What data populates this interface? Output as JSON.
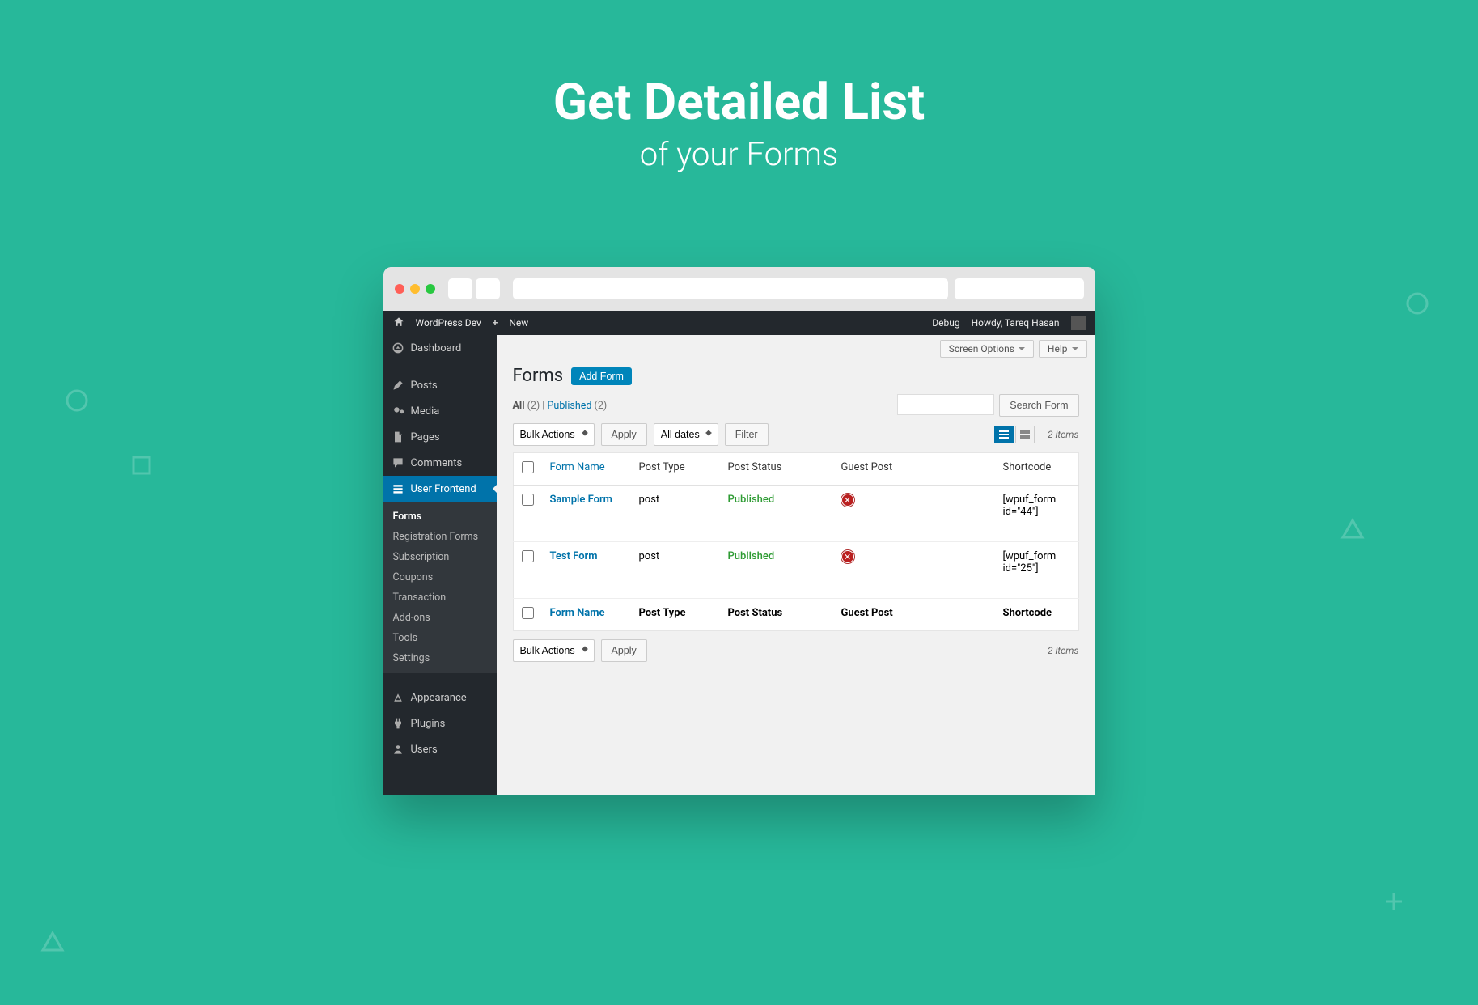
{
  "hero": {
    "line1": "Get Detailed List",
    "line2": "of your Forms"
  },
  "adminbar": {
    "site": "WordPress Dev",
    "new": "New",
    "debug": "Debug",
    "howdy": "Howdy, Tareq Hasan"
  },
  "sidebar": {
    "dashboard": "Dashboard",
    "posts": "Posts",
    "media": "Media",
    "pages": "Pages",
    "comments": "Comments",
    "user_frontend": "User Frontend",
    "appearance": "Appearance",
    "plugins": "Plugins",
    "users": "Users",
    "submenu": {
      "forms": "Forms",
      "registration": "Registration Forms",
      "subscription": "Subscription",
      "coupons": "Coupons",
      "transaction": "Transaction",
      "addons": "Add-ons",
      "tools": "Tools",
      "settings": "Settings"
    }
  },
  "page": {
    "title": "Forms",
    "add_button": "Add Form",
    "screen_options": "Screen Options",
    "help": "Help",
    "status_all": "All",
    "status_all_count": "(2)",
    "status_sep": "  |  ",
    "status_published": "Published",
    "status_published_count": "(2)",
    "search_button": "Search Form",
    "bulk_actions": "Bulk Actions",
    "apply": "Apply",
    "all_dates": "All dates",
    "filter": "Filter",
    "items_text": "2 items"
  },
  "columns": {
    "form_name": "Form Name",
    "post_type": "Post Type",
    "post_status": "Post Status",
    "guest_post": "Guest Post",
    "shortcode": "Shortcode"
  },
  "rows": [
    {
      "name": "Sample Form",
      "post_type": "post",
      "status": "Published",
      "guest": false,
      "shortcode": "[wpuf_form id=\"44\"]"
    },
    {
      "name": "Test Form",
      "post_type": "post",
      "status": "Published",
      "guest": false,
      "shortcode": "[wpuf_form id=\"25\"]"
    }
  ]
}
